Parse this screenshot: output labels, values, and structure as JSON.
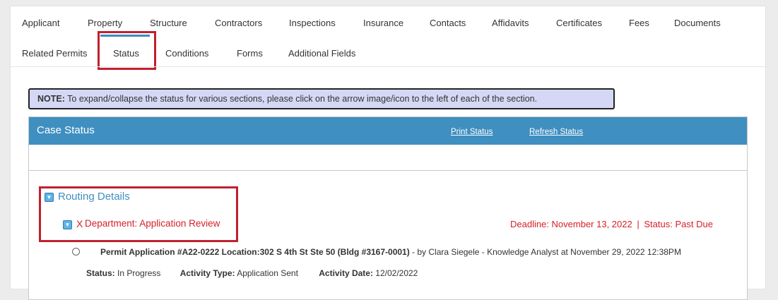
{
  "tabs_row1": [
    "Applicant",
    "Property",
    "Structure",
    "Contractors",
    "Inspections",
    "Insurance",
    "Contacts",
    "Affidavits",
    "Certificates",
    "Fees",
    "Documents"
  ],
  "tabs_row2": [
    "Related Permits",
    "Status",
    "Conditions",
    "Forms",
    "Additional Fields"
  ],
  "active_tab": "Status",
  "note": {
    "label": "NOTE:",
    "text": "To expand/collapse the status for various sections, please click on the arrow image/icon to the left of each of the section."
  },
  "case_status": {
    "title": "Case Status",
    "print_link": "Print Status",
    "refresh_link": "Refresh Status"
  },
  "routing": {
    "label": "Routing Details",
    "department_mark": "X",
    "department_label": "Department: Application Review",
    "deadline_text": "Deadline: November 13, 2022",
    "separator": "|",
    "status_text": "Status: Past Due"
  },
  "activity": {
    "title_bold": "Permit Application #A22-0222 Location:302 S 4th St Ste 50 (Bldg #3167-0001)",
    "title_rest": " - by Clara Siegele - Knowledge Analyst at November 29, 2022 12:38PM",
    "status_label": "Status:",
    "status_value": "In Progress",
    "type_label": "Activity Type:",
    "type_value": "Application Sent",
    "date_label": "Activity Date:",
    "date_value": "12/02/2022"
  },
  "colors": {
    "accent": "#3f8fc0",
    "highlight": "#c0202e",
    "alert": "#d61f26",
    "note_bg": "#d5d8f5"
  },
  "icons": [
    "collapse-toggle-icon",
    "x-mark-icon",
    "radio-icon"
  ]
}
